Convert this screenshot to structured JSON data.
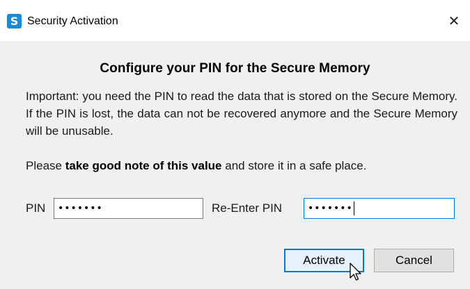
{
  "window": {
    "title": "Security Activation",
    "app_icon_letter": "S",
    "close_glyph": "✕",
    "accent_color": "#0078d7",
    "icon_color": "#1b8ad7"
  },
  "content": {
    "heading": "Configure your PIN for the Secure Memory",
    "paragraph1": "Important: you need the PIN to read the data that is stored on the Secure Memory. If the PIN is lost, the data can not be recovered anymore and the Secure Memory will be unusable.",
    "paragraph2_prefix": "Please ",
    "paragraph2_bold": "take good note of this value",
    "paragraph2_suffix": " and store it in a safe place."
  },
  "form": {
    "pin_label": "PIN",
    "pin_value_masked": "•••••••",
    "reenter_label": "Re-Enter PIN",
    "reenter_value_masked": "•••••••"
  },
  "buttons": {
    "activate_label": "Activate",
    "cancel_label": "Cancel"
  },
  "icons": {
    "app": "shield-s-app-icon",
    "close": "close-icon",
    "cursor": "mouse-pointer-icon"
  }
}
